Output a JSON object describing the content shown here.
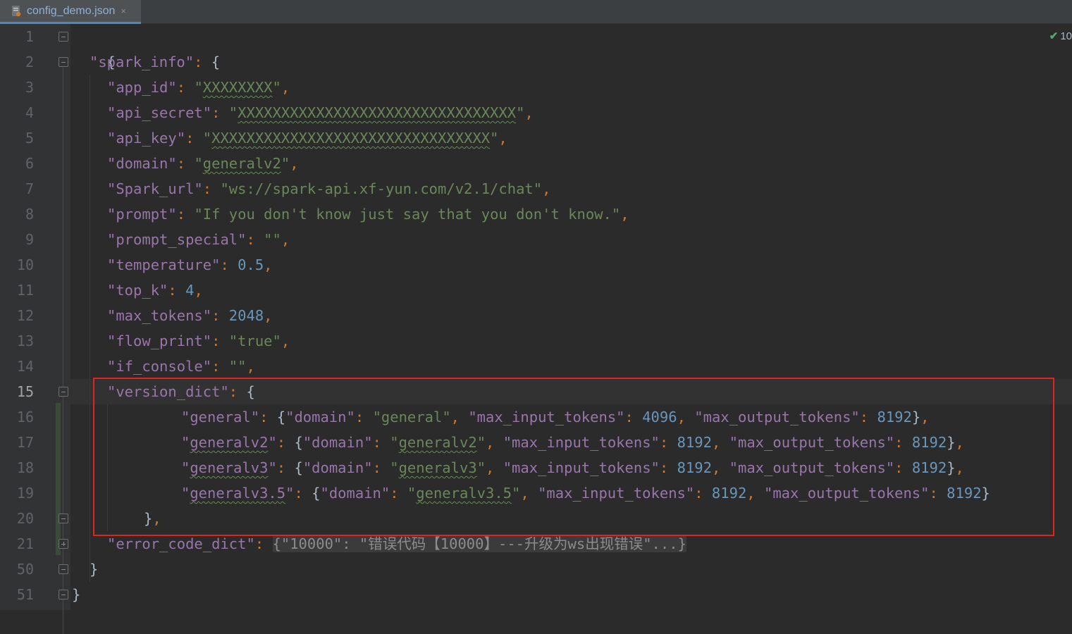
{
  "tab": {
    "filename": "config_demo.json",
    "close": "×",
    "icon": "json-file-icon"
  },
  "inspection": {
    "count": "10",
    "icon": "checkmark-icon",
    "color": "#59a869"
  },
  "line_numbers": [
    "1",
    "2",
    "3",
    "4",
    "5",
    "6",
    "7",
    "8",
    "9",
    "10",
    "11",
    "12",
    "13",
    "14",
    "15",
    "16",
    "17",
    "18",
    "19",
    "20",
    "21",
    "50",
    "51"
  ],
  "code": {
    "l1": {
      "brace": "{"
    },
    "l2": {
      "key": "\"spark_info\"",
      "colon": ": ",
      "brace": "{"
    },
    "l3": {
      "key": "\"app_id\"",
      "colon": ": ",
      "q1": "\"",
      "val": "XXXXXXXX",
      "q2": "\"",
      "comma": ","
    },
    "l4": {
      "key": "\"api_secret\"",
      "colon": ": ",
      "q1": "\"",
      "val": "XXXXXXXXXXXXXXXXXXXXXXXXXXXXXXXX",
      "q2": "\"",
      "comma": ","
    },
    "l5": {
      "key": "\"api_key\"",
      "colon": ": ",
      "q1": "\"",
      "val": "XXXXXXXXXXXXXXXXXXXXXXXXXXXXXXXX",
      "q2": "\"",
      "comma": ","
    },
    "l6": {
      "key": "\"domain\"",
      "colon": ": ",
      "q1": "\"",
      "val": "generalv2",
      "q2": "\"",
      "comma": ","
    },
    "l7": {
      "key": "\"Spark_url\"",
      "colon": ": ",
      "val": "\"ws://spark-api.xf-yun.com/v2.1/chat\"",
      "comma": ","
    },
    "l8": {
      "key": "\"prompt\"",
      "colon": ": ",
      "val": "\"If you don't know just say that you don't know.\"",
      "comma": ","
    },
    "l9": {
      "key": "\"prompt_special\"",
      "colon": ": ",
      "val": "\"\"",
      "comma": ","
    },
    "l10": {
      "key": "\"temperature\"",
      "colon": ": ",
      "val": "0.5",
      "comma": ","
    },
    "l11": {
      "key": "\"top_k\"",
      "colon": ": ",
      "val": "4",
      "comma": ","
    },
    "l12": {
      "key": "\"max_tokens\"",
      "colon": ": ",
      "val": "2048",
      "comma": ","
    },
    "l13": {
      "key": "\"flow_print\"",
      "colon": ": ",
      "val": "\"true\"",
      "comma": ","
    },
    "l14": {
      "key": "\"if_console\"",
      "colon": ": ",
      "val": "\"\"",
      "comma": ","
    },
    "l15": {
      "key": "\"version_dict\"",
      "colon": ": ",
      "brace": "{"
    },
    "versions": [
      {
        "key_a": "\"",
        "key_b": "general",
        "key_c": "\"",
        "colon": ": ",
        "open": "{",
        "dkey": "\"domain\"",
        "dcolon": ": ",
        "dq1": "\"",
        "dval": "general",
        "dq2": "\"",
        "sep1": ", ",
        "ikey": "\"max_input_tokens\"",
        "icolon": ": ",
        "ival": "4096",
        "sep2": ", ",
        "okey": "\"max_output_tokens\"",
        "ocolon": ": ",
        "oval": "8192",
        "close": "}",
        "comma": ","
      },
      {
        "key_a": "\"",
        "key_b": "generalv2",
        "key_c": "\"",
        "colon": ": ",
        "open": "{",
        "dkey": "\"domain\"",
        "dcolon": ": ",
        "dq1": "\"",
        "dval": "generalv2",
        "dq2": "\"",
        "sep1": ", ",
        "ikey": "\"max_input_tokens\"",
        "icolon": ": ",
        "ival": "8192",
        "sep2": ", ",
        "okey": "\"max_output_tokens\"",
        "ocolon": ": ",
        "oval": "8192",
        "close": "}",
        "comma": ","
      },
      {
        "key_a": "\"",
        "key_b": "generalv3",
        "key_c": "\"",
        "colon": ": ",
        "open": "{",
        "dkey": "\"domain\"",
        "dcolon": ": ",
        "dq1": "\"",
        "dval": "generalv3",
        "dq2": "\"",
        "sep1": ", ",
        "ikey": "\"max_input_tokens\"",
        "icolon": ": ",
        "ival": "8192",
        "sep2": ", ",
        "okey": "\"max_output_tokens\"",
        "ocolon": ": ",
        "oval": "8192",
        "close": "}",
        "comma": ","
      },
      {
        "key_a": "\"",
        "key_b": "generalv3.5",
        "key_c": "\"",
        "colon": ": ",
        "open": "{",
        "dkey": "\"domain\"",
        "dcolon": ": ",
        "dq1": "\"",
        "dval": "generalv3.5",
        "dq2": "\"",
        "sep1": ", ",
        "ikey": "\"max_input_tokens\"",
        "icolon": ": ",
        "ival": "8192",
        "sep2": ", ",
        "okey": "\"max_output_tokens\"",
        "ocolon": ": ",
        "oval": "8192",
        "close": "}",
        "comma": ""
      }
    ],
    "l20": {
      "brace": "}",
      "comma": ","
    },
    "l21": {
      "key": "\"error_code_dict\"",
      "colon": ": ",
      "folded": "{\"10000\": \"错误代码【10000】---升级为ws出现错误\"...}"
    },
    "l50": {
      "brace": "}"
    },
    "l51": {
      "brace": "}"
    }
  },
  "colors": {
    "background": "#2b2b2b",
    "key": "#9876aa",
    "string": "#6a8759",
    "number": "#6897bb",
    "punctuation": "#cc7832",
    "highlight_box": "#e0261a"
  }
}
